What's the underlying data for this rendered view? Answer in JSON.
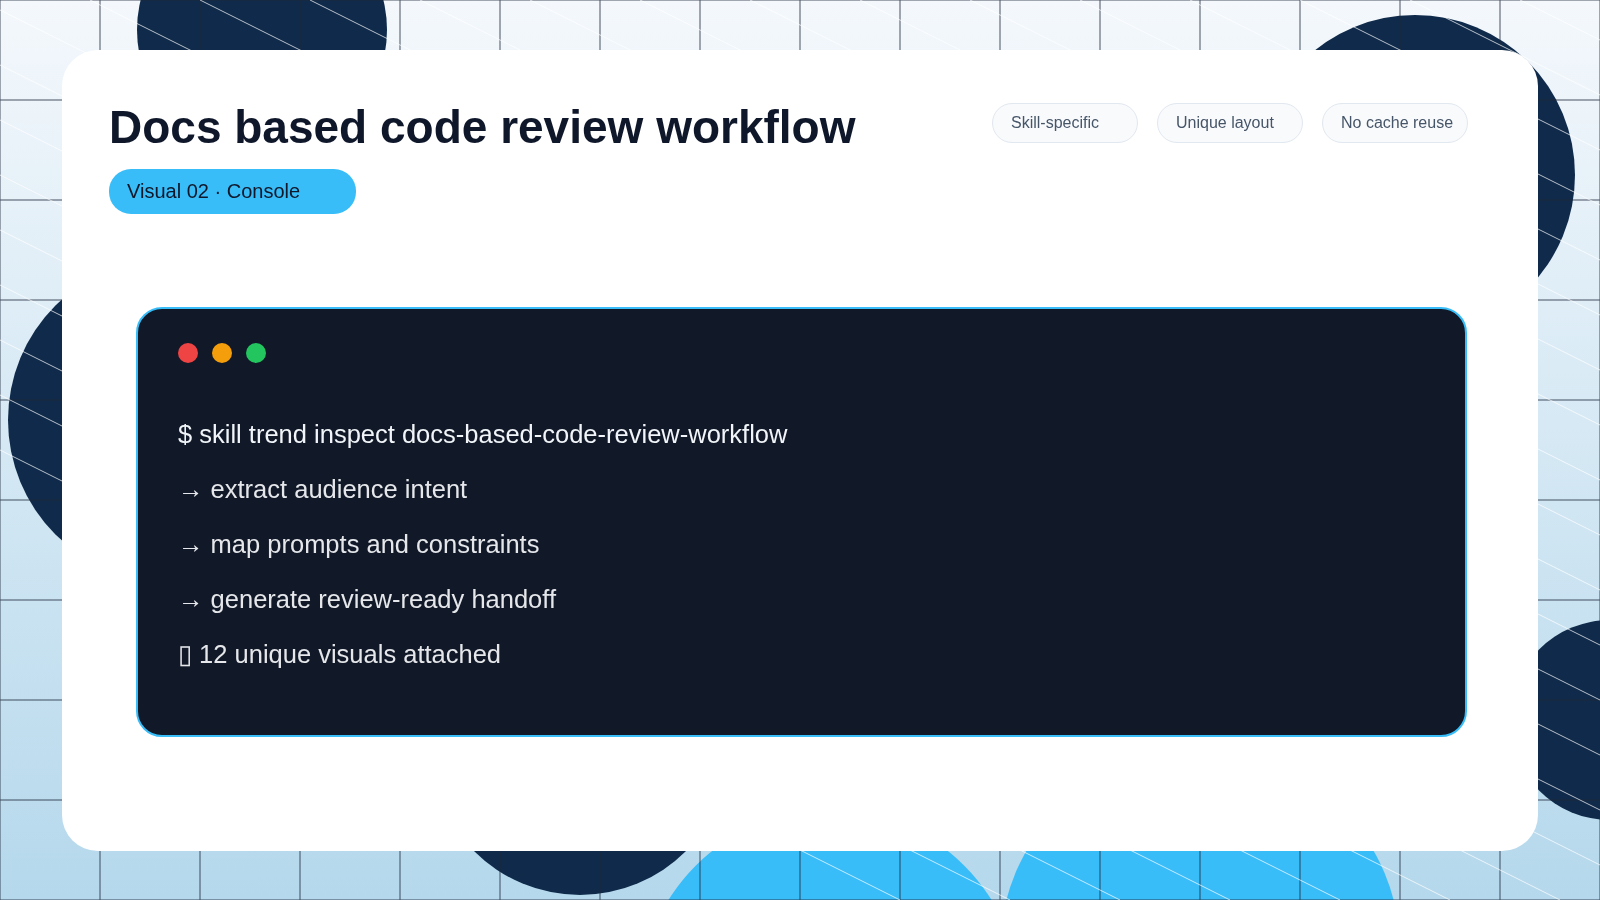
{
  "title": "Docs based code review workflow",
  "badge": "Visual 02 · Console",
  "tags": [
    "Skill-specific",
    "Unique layout",
    "No cache reuse"
  ],
  "console": {
    "window_dots": [
      {
        "color": "#ef4444"
      },
      {
        "color": "#f59e0b"
      },
      {
        "color": "#22c55e"
      }
    ],
    "lines": [
      {
        "kind": "command",
        "text": "$ skill trend inspect docs-based-code-review-workflow"
      },
      {
        "kind": "step",
        "text": "→ extract audience intent"
      },
      {
        "kind": "step",
        "text": "→ map prompts and constraints"
      },
      {
        "kind": "step",
        "text": "→ generate review-ready handoff"
      },
      {
        "kind": "result",
        "text": "▯ 12 unique visuals attached"
      }
    ]
  }
}
